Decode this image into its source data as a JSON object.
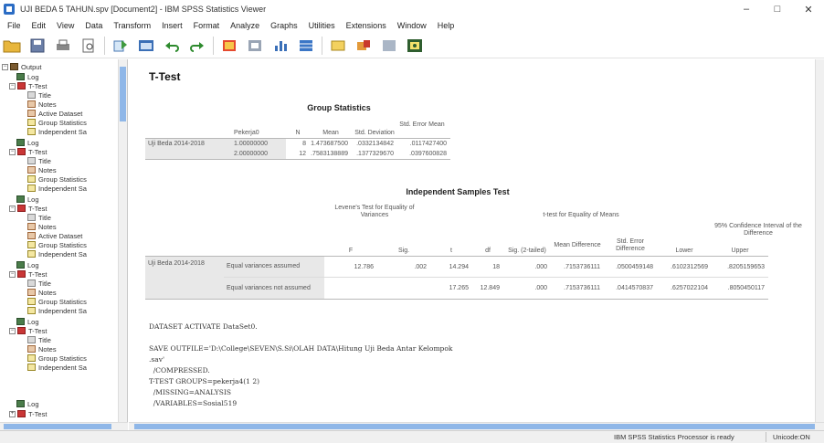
{
  "window": {
    "title": "UJI BEDA 5 TAHUN.spv [Document2] - IBM SPSS Statistics Viewer",
    "controls": [
      "–",
      "□",
      "✕"
    ]
  },
  "menu": [
    "File",
    "Edit",
    "View",
    "Data",
    "Transform",
    "Insert",
    "Format",
    "Analyze",
    "Graphs",
    "Utilities",
    "Extensions",
    "Window",
    "Help"
  ],
  "toolbar_icons": [
    "open-folder-icon",
    "save-icon",
    "print-icon",
    "print-preview-icon",
    "export-icon",
    "recall-dialog-icon",
    "undo-icon",
    "redo-icon",
    "goto-data-icon",
    "goto-case-icon",
    "goto-variable-icon",
    "variables-icon",
    "show-all-icon",
    "insert-output-icon",
    "designate-window-icon"
  ],
  "outline": {
    "nodes": [
      {
        "label": "Output",
        "icon": "book",
        "indent": 0,
        "toggle": "−"
      },
      {
        "label": "Log",
        "icon": "log",
        "indent": 1
      },
      {
        "label": "T-Test",
        "icon": "red",
        "indent": 1,
        "toggle": "−"
      },
      {
        "label": "Title",
        "icon": "doc",
        "indent": 2
      },
      {
        "label": "Notes",
        "icon": "note",
        "indent": 2
      },
      {
        "label": "Active Dataset",
        "icon": "note",
        "indent": 2
      },
      {
        "label": "Group Statistics",
        "icon": "table",
        "indent": 2
      },
      {
        "label": "Independent Sa",
        "icon": "table",
        "indent": 2
      },
      {
        "label": "Log",
        "icon": "log",
        "indent": 1
      },
      {
        "label": "T-Test",
        "icon": "red",
        "indent": 1,
        "toggle": "−"
      },
      {
        "label": "Title",
        "icon": "doc",
        "indent": 2
      },
      {
        "label": "Notes",
        "icon": "note",
        "indent": 2
      },
      {
        "label": "Group Statistics",
        "icon": "table",
        "indent": 2
      },
      {
        "label": "Independent Sa",
        "icon": "table",
        "indent": 2
      },
      {
        "label": "Log",
        "icon": "log",
        "indent": 1
      },
      {
        "label": "T-Test",
        "icon": "red",
        "indent": 1,
        "toggle": "−"
      },
      {
        "label": "Title",
        "icon": "doc",
        "indent": 2
      },
      {
        "label": "Notes",
        "icon": "note",
        "indent": 2
      },
      {
        "label": "Active Dataset",
        "icon": "note",
        "indent": 2
      },
      {
        "label": "Group Statistics",
        "icon": "table",
        "indent": 2
      },
      {
        "label": "Independent Sa",
        "icon": "table",
        "indent": 2
      },
      {
        "label": "Log",
        "icon": "log",
        "indent": 1
      },
      {
        "label": "T-Test",
        "icon": "red",
        "indent": 1,
        "toggle": "−"
      },
      {
        "label": "Title",
        "icon": "doc",
        "indent": 2
      },
      {
        "label": "Notes",
        "icon": "note",
        "indent": 2
      },
      {
        "label": "Group Statistics",
        "icon": "table",
        "indent": 2
      },
      {
        "label": "Independent Sa",
        "icon": "table",
        "indent": 2
      },
      {
        "label": "Log",
        "icon": "log",
        "indent": 1
      },
      {
        "label": "T-Test",
        "icon": "red",
        "indent": 1,
        "toggle": "−"
      },
      {
        "label": "Title",
        "icon": "doc",
        "indent": 2
      },
      {
        "label": "Notes",
        "icon": "note",
        "indent": 2
      },
      {
        "label": "Group Statistics",
        "icon": "table",
        "indent": 2
      },
      {
        "label": "Independent Sa",
        "icon": "table",
        "indent": 2
      },
      {
        "label": "Log",
        "icon": "log",
        "indent": 1
      },
      {
        "label": "T-Test",
        "icon": "red",
        "indent": 1,
        "toggle": "+"
      }
    ]
  },
  "content": {
    "heading": "T-Test",
    "group_stats": {
      "title": "Group Statistics",
      "headers": [
        "Pekerja0",
        "N",
        "Mean",
        "Std. Deviation",
        "Std. Error Mean"
      ],
      "row_label": "Uji Beda 2014-2018",
      "rows": [
        [
          "1.00000000",
          "8",
          "1.473687500",
          ".0332134842",
          ".0117427400"
        ],
        [
          "2.00000000",
          "12",
          ".7583138889",
          ".1377329670",
          ".0397600828"
        ]
      ]
    },
    "indep_test": {
      "title": "Independent Samples Test",
      "levene_header": "Levene's Test for Equality of Variances",
      "ttest_header": "t-test for Equality of Means",
      "ci_header": "95% Confidence Interval of the Difference",
      "col_headers": [
        "F",
        "Sig.",
        "t",
        "df",
        "Sig. (2-tailed)",
        "Mean Difference",
        "Std. Error Difference",
        "Lower",
        "Upper"
      ],
      "row_label": "Uji Beda 2014-2018",
      "rows": [
        {
          "label": "Equal variances assumed",
          "values": [
            "12.786",
            ".002",
            "14.294",
            "18",
            ".000",
            ".7153736111",
            ".0500459148",
            ".6102312569",
            ".8205159653"
          ]
        },
        {
          "label": "Equal variances not assumed",
          "values": [
            "",
            "",
            "17.265",
            "12.849",
            ".000",
            ".7153736111",
            ".0414570837",
            ".6257022104",
            ".8050450117"
          ]
        }
      ]
    },
    "syntax_lines": [
      "DATASET ACTIVATE DataSet0.",
      "",
      "SAVE OUTFILE='D:\\College\\SEVEN\\S.Si\\OLAH DATA\\Hitung Uji Beda Antar Kelompok",
      ".sav'",
      "  /COMPRESSED.",
      "T-TEST GROUPS=pekerja4(1 2)",
      "  /MISSING=ANALYSIS",
      "  /VARIABLES=Sosial519"
    ]
  },
  "status": {
    "message": "IBM SPSS Statistics Processor is ready",
    "encoding": "Unicode:ON"
  }
}
